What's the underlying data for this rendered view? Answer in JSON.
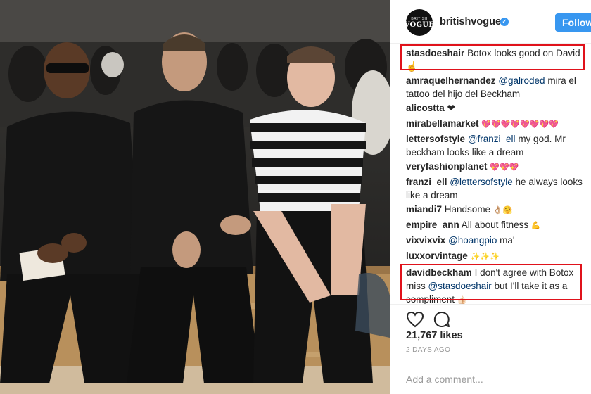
{
  "post": {
    "username": "britishvogue",
    "avatar_line1": "BRITISH",
    "avatar_line2": "VOGUE",
    "verified_icon": "verified-badge-icon",
    "follow_label": "Follow",
    "accent_color": "#3897f0"
  },
  "comments": [
    {
      "user": "stasdoeshair",
      "text": "Botox looks good on David !",
      "emoji": "☝"
    },
    {
      "user": "amraquelhernandez",
      "mention": "@galroded",
      "text": "mira el tattoo del hijo del Beckham"
    },
    {
      "user": "alicostta",
      "emoji": "❤"
    },
    {
      "user": "mirabellamarket",
      "emoji": "💖💖💖💖💖💖💖💖"
    },
    {
      "user": "lettersofstyle",
      "mention": "@franzi_ell",
      "text": "my god. Mr beckham looks like a dream"
    },
    {
      "user": "veryfashionplanet",
      "emoji": "💖💖💖"
    },
    {
      "user": "franzi_ell",
      "mention": "@lettersofstyle",
      "text": "he always looks like a dream"
    },
    {
      "user": "miandi7",
      "text": "Handsome",
      "emoji": "👌🏼🤗"
    },
    {
      "user": "empire_ann",
      "text": "All about fitness",
      "emoji": "💪"
    },
    {
      "user": "vixvixvix",
      "mention": "@hoangpio",
      "text": "ma'"
    },
    {
      "user": "luxxorvintage",
      "emoji": "✨✨✨"
    },
    {
      "user": "davidbeckham",
      "text": "I don't agree with Botox miss",
      "mention": "@stasdoeshair",
      "text2": "but I'll take it as a compliment",
      "emoji": "👍🏻"
    }
  ],
  "likes": "21,767 likes",
  "time_ago": "2 DAYS AGO",
  "add_comment_placeholder": "Add a comment...",
  "highlight_color": "#e0121b"
}
